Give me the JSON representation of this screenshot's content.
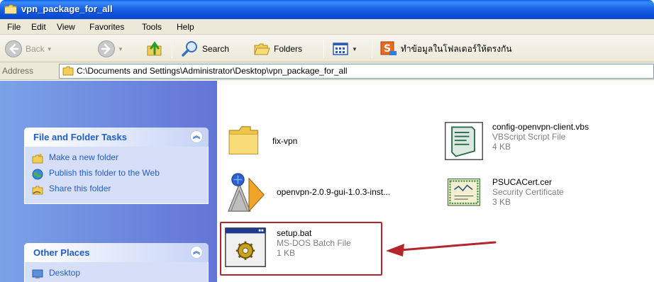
{
  "window": {
    "title": "vpn_package_for_all"
  },
  "menu": [
    "File",
    "Edit",
    "View",
    "Favorites",
    "Tools",
    "Help"
  ],
  "toolbar": {
    "back_label": "Back",
    "search_label": "Search",
    "folders_label": "Folders",
    "thai_label": "ทำข้อมูลในโฟลเดอร์ให้ตรงกัน"
  },
  "address": {
    "label": "Address",
    "path": "C:\\Documents and Settings\\Administrator\\Desktop\\vpn_package_for_all"
  },
  "tasks_panel": {
    "title": "File and Folder Tasks",
    "items": [
      "Make a new folder",
      "Publish this folder to the Web",
      "Share this folder"
    ]
  },
  "places_panel": {
    "title": "Other Places",
    "items": [
      "Desktop"
    ]
  },
  "files": [
    {
      "name": "fix-vpn",
      "type": "",
      "size": "",
      "icon": "folder-icon"
    },
    {
      "name": "config-openvpn-client.vbs",
      "type": "VBScript Script File",
      "size": "4 KB",
      "icon": "vbscript-icon"
    },
    {
      "name": "openvpn-2.0.9-gui-1.0.3-inst...",
      "type": "",
      "size": "",
      "icon": "openvpn-installer-icon"
    },
    {
      "name": "PSUCACert.cer",
      "type": "Security Certificate",
      "size": "3 KB",
      "icon": "certificate-icon"
    },
    {
      "name": "setup.bat",
      "type": "MS-DOS Batch File",
      "size": "1 KB",
      "icon": "batch-file-icon"
    }
  ],
  "colors": {
    "titlebar": "#0a4fd8",
    "taskpane": "#6375d6",
    "panel_title": "#215dc6",
    "highlight": "#b2262c"
  }
}
